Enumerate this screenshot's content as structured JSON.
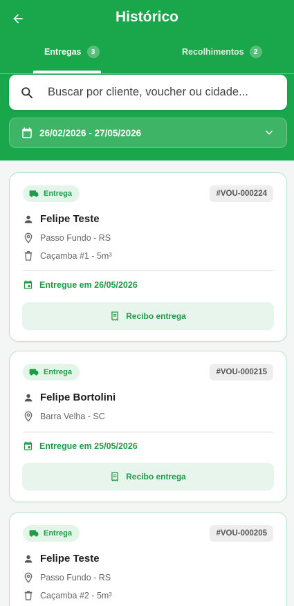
{
  "colors": {
    "primary": "#1aa64a",
    "accent_text": "#1f9a46",
    "card_border": "#b9e6c8"
  },
  "header": {
    "title": "Histórico",
    "back_icon": "arrow-left-icon"
  },
  "tabs": [
    {
      "label": "Entregas",
      "count": "3",
      "active": true
    },
    {
      "label": "Recolhimentos",
      "count": "2",
      "active": false
    }
  ],
  "search": {
    "placeholder": "Buscar por cliente, voucher ou cidade...",
    "value": ""
  },
  "date_filter": {
    "value": "26/02/2026 - 27/05/2026"
  },
  "cards": [
    {
      "type_label": "Entrega",
      "voucher": "#VOU-000224",
      "client": "Felipe Teste",
      "location": "Passo Fundo - RS",
      "container": "Caçamba #1 - 5m³",
      "delivered": "Entregue em 26/05/2026",
      "button": "Recibo entrega"
    },
    {
      "type_label": "Entrega",
      "voucher": "#VOU-000215",
      "client": "Felipe Bortolini",
      "location": "Barra Velha - SC",
      "delivered": "Entregue em 25/05/2026",
      "button": "Recibo entrega"
    },
    {
      "type_label": "Entrega",
      "voucher": "#VOU-000205",
      "client": "Felipe Teste",
      "location": "Passo Fundo - RS",
      "container": "Caçamba #2 - 5m³"
    }
  ]
}
